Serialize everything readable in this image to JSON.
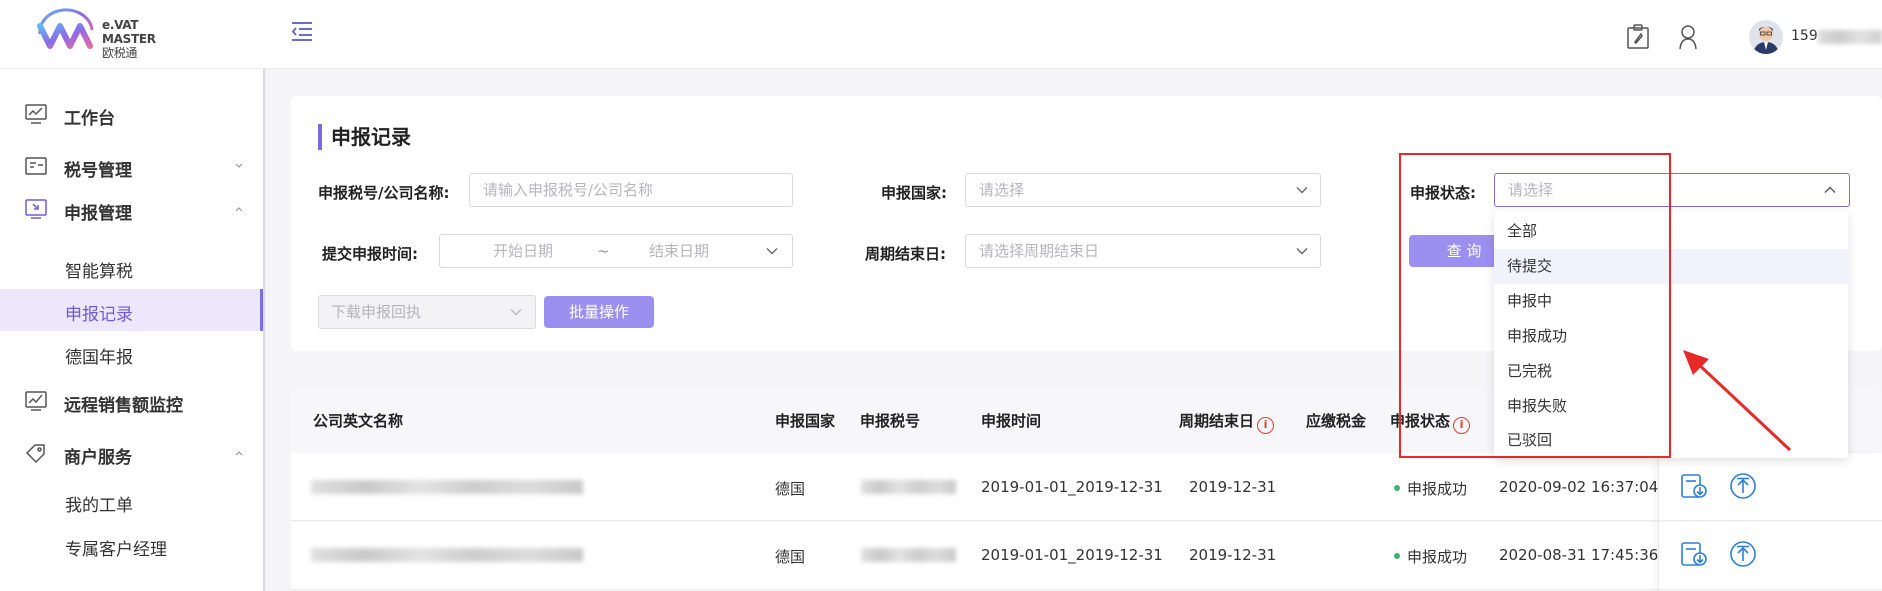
{
  "brand": {
    "line1": "e.VAT",
    "line2": "MASTER",
    "line3": "欧税通"
  },
  "user": {
    "name_prefix": "159"
  },
  "sidebar": {
    "items": [
      {
        "label": "工作台"
      },
      {
        "label": "税号管理"
      },
      {
        "label": "申报管理"
      },
      {
        "label": "智能算税"
      },
      {
        "label": "申报记录"
      },
      {
        "label": "德国年报"
      },
      {
        "label": "远程销售额监控"
      },
      {
        "label": "商户服务"
      },
      {
        "label": "我的工单"
      },
      {
        "label": "专属客户经理"
      }
    ]
  },
  "filters": {
    "title": "申报记录",
    "tax_label": "申报税号/公司名称:",
    "tax_placeholder": "请输入申报税号/公司名称",
    "country_label": "申报国家:",
    "country_placeholder": "请选择",
    "status_label": "申报状态:",
    "status_placeholder": "请选择",
    "submit_time_label": "提交申报时间:",
    "start_date": "开始日期",
    "date_sep": "~",
    "end_date": "结束日期",
    "period_end_label": "周期结束日:",
    "period_end_placeholder": "请选择周期结束日",
    "query_button": "查 询",
    "download_placeholder": "下载申报回执",
    "batch_button": "批量操作"
  },
  "status_options": [
    "全部",
    "待提交",
    "申报中",
    "申报成功",
    "已完税",
    "申报失败",
    "已驳回"
  ],
  "table": {
    "columns": [
      "公司英文名称",
      "申报国家",
      "申报税号",
      "申报时间",
      "周期结束日",
      "应缴税金",
      "申报状态"
    ],
    "rows": [
      {
        "country": "德国",
        "period": "2019-01-01_2019-12-31",
        "end": "2019-12-31",
        "status": "申报成功",
        "time": "2020-09-02 16:37:04"
      },
      {
        "country": "德国",
        "period": "2019-01-01_2019-12-31",
        "end": "2019-12-31",
        "status": "申报成功",
        "time": "2020-08-31 17:45:36"
      }
    ]
  },
  "colors": {
    "accent": "#7b6be0",
    "annotation": "#e62929",
    "success": "#3cb371"
  }
}
